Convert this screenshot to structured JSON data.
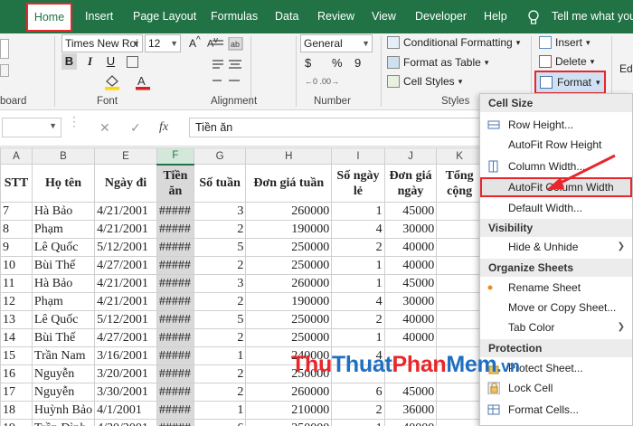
{
  "tabs": [
    "Home",
    "Insert",
    "Page Layout",
    "Formulas",
    "Data",
    "Review",
    "View",
    "Developer",
    "Help"
  ],
  "tell_me": "Tell me what you",
  "ribbon": {
    "clipboard_label": "board",
    "font_name": "Times New Roi",
    "font_size": "12",
    "bold": "B",
    "italic": "I",
    "underline": "U",
    "font_label": "Font",
    "alignment_label": "Alignment",
    "number_format": "General",
    "currency": "$",
    "percent": "%",
    "comma": "9",
    "number_label": "Number",
    "conditional_formatting": "Conditional Formatting",
    "format_as_table": "Format as Table",
    "cell_styles": "Cell Styles",
    "styles_label": "Styles",
    "insert": "Insert",
    "delete": "Delete",
    "format": "Format",
    "edit": "Edi"
  },
  "formula_bar": {
    "cancel": "✕",
    "enter": "✓",
    "fx": "fx",
    "content": "Tiền ăn"
  },
  "columns": [
    "A",
    "B",
    "E",
    "F",
    "G",
    "H",
    "I",
    "J",
    "K"
  ],
  "headers": [
    "STT",
    "Họ tên",
    "Ngày đi",
    "Tiền ăn",
    "Số tuần",
    "Đơn giá tuần",
    "Số ngày lẻ",
    "Đơn giá ngày",
    "Tổng cộng"
  ],
  "rows": [
    [
      "7",
      "Hà Bảo",
      "4/21/2001",
      "#####",
      "3",
      "260000",
      "1",
      "45000",
      ""
    ],
    [
      "8",
      "Phạm",
      "4/21/2001",
      "#####",
      "2",
      "190000",
      "4",
      "30000",
      ""
    ],
    [
      "9",
      "Lê Quốc",
      "5/12/2001",
      "#####",
      "5",
      "250000",
      "2",
      "40000",
      ""
    ],
    [
      "10",
      "Bùi Thế",
      "4/27/2001",
      "#####",
      "2",
      "250000",
      "1",
      "40000",
      ""
    ],
    [
      "11",
      "Hà Bảo",
      "4/21/2001",
      "#####",
      "3",
      "260000",
      "1",
      "45000",
      ""
    ],
    [
      "12",
      "Phạm",
      "4/21/2001",
      "#####",
      "2",
      "190000",
      "4",
      "30000",
      ""
    ],
    [
      "13",
      "Lê Quốc",
      "5/12/2001",
      "#####",
      "5",
      "250000",
      "2",
      "40000",
      ""
    ],
    [
      "14",
      "Bùi Thế",
      "4/27/2001",
      "#####",
      "2",
      "250000",
      "1",
      "40000",
      ""
    ],
    [
      "15",
      "Trần Nam",
      "3/16/2001",
      "#####",
      "1",
      "240000",
      "4",
      "",
      ""
    ],
    [
      "16",
      "Nguyễn",
      "3/20/2001",
      "#####",
      "2",
      "250000",
      "",
      "",
      ""
    ],
    [
      "17",
      "Nguyễn",
      "3/30/2001",
      "#####",
      "2",
      "260000",
      "6",
      "45000",
      ""
    ],
    [
      "18",
      "Huỳnh Bảo",
      "4/1/2001",
      "#####",
      "1",
      "210000",
      "2",
      "36000",
      ""
    ],
    [
      "19",
      "Trần Đình",
      "4/30/2001",
      "#####",
      "6",
      "250000",
      "1",
      "40000",
      ""
    ]
  ],
  "menu": {
    "cell_size": "Cell Size",
    "row_height": "Row Height...",
    "autofit_row": "AutoFit Row Height",
    "column_width": "Column Width...",
    "autofit_column": "AutoFit Column Width",
    "default_width": "Default Width...",
    "visibility": "Visibility",
    "hide_unhide": "Hide & Unhide",
    "organize": "Organize Sheets",
    "rename": "Rename Sheet",
    "move_copy": "Move or Copy Sheet...",
    "tab_color": "Tab Color",
    "protection": "Protection",
    "protect_sheet": "Protect Sheet...",
    "lock_cell": "Lock Cell",
    "format_cells": "Format Cells..."
  },
  "watermark": {
    "part1": "Thu",
    "part2": "Thuat",
    "part3": "Phan",
    "part4": "Mem",
    ".vn": ".vn"
  },
  "colors": {
    "excel_green": "#217346",
    "highlight_red": "#e8262b",
    "watermark_red": "#e8262b",
    "watermark_blue": "#1f6fbf"
  }
}
